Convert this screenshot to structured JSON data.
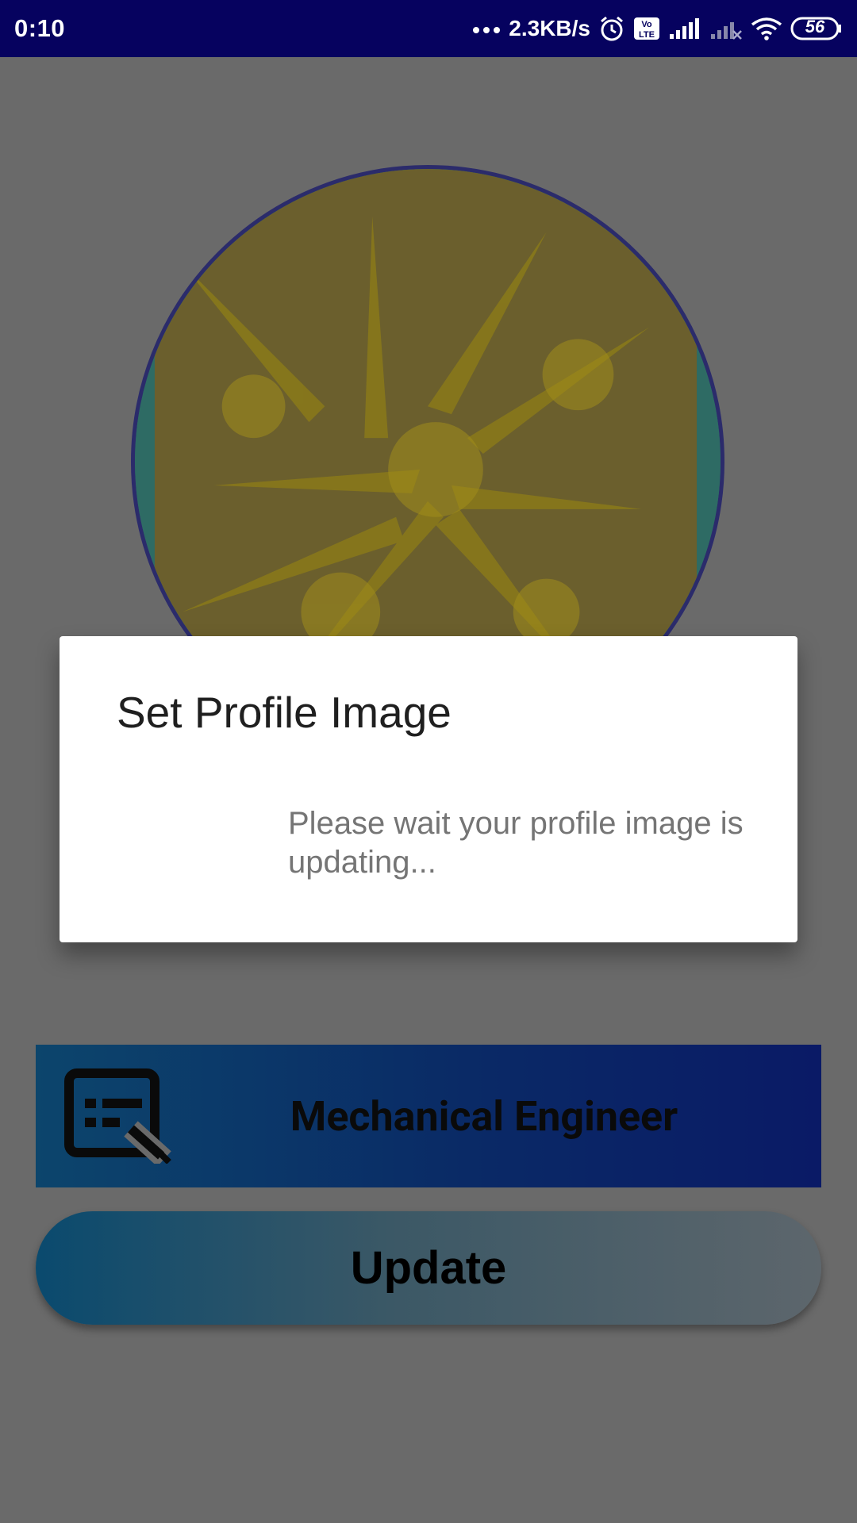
{
  "status_bar": {
    "time": "0:10",
    "net_speed": "2.3KB/s",
    "battery": "56",
    "icons": [
      "more-dots-icon",
      "alarm-icon",
      "volte-icon",
      "signal-icon",
      "signal-off-icon",
      "wifi-icon",
      "battery-icon"
    ]
  },
  "profile": {
    "profession": "Mechanical Engineer",
    "update_label": "Update"
  },
  "dialog": {
    "title": "Set Profile Image",
    "message": "Please wait your profile image is updating..."
  },
  "colors": {
    "status_bar": "#06025f",
    "scrim": "#6a6a6a",
    "dialog_bg": "#ffffff",
    "avatar_border": "#2b2b6b",
    "avatar_fill": "#6b5f2d"
  }
}
